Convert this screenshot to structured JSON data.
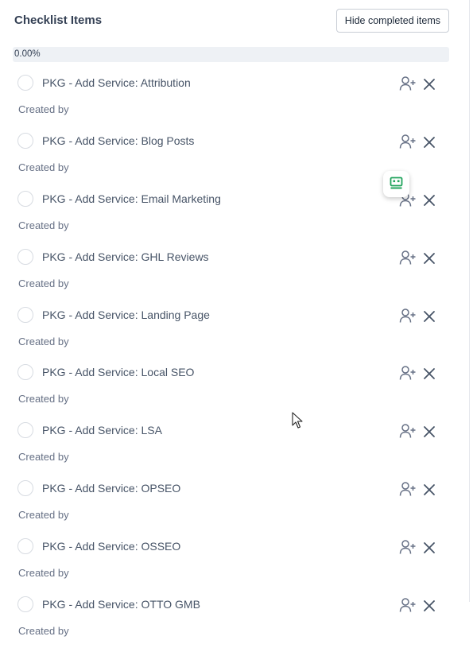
{
  "header": {
    "title": "Checklist Items",
    "hide_button_label": "Hide completed items"
  },
  "progress": {
    "label": "0.00%",
    "value_percent": 0
  },
  "items": [
    {
      "label": "PKG - Add Service: Attribution",
      "meta": "Created by"
    },
    {
      "label": "PKG - Add Service: Blog Posts",
      "meta": "Created by"
    },
    {
      "label": "PKG - Add Service: Email Marketing",
      "meta": "Created by"
    },
    {
      "label": "PKG - Add Service: GHL Reviews",
      "meta": "Created by"
    },
    {
      "label": "PKG - Add Service: Landing Page",
      "meta": "Created by"
    },
    {
      "label": "PKG - Add Service: Local SEO",
      "meta": "Created by"
    },
    {
      "label": "PKG - Add Service: LSA",
      "meta": "Created by"
    },
    {
      "label": "PKG - Add Service: OPSEO",
      "meta": "Created by"
    },
    {
      "label": "PKG - Add Service: OSSEO",
      "meta": "Created by"
    },
    {
      "label": "PKG - Add Service: OTTO GMB",
      "meta": "Created by"
    }
  ],
  "icons": {
    "checkbox": "circle-checkbox-icon",
    "assign": "add-user-icon",
    "remove": "close-icon",
    "floating": "chat-widget-icon"
  },
  "colors": {
    "accent_green": "#22a45d",
    "progress_track": "#eef1f5",
    "text": "#475467"
  }
}
